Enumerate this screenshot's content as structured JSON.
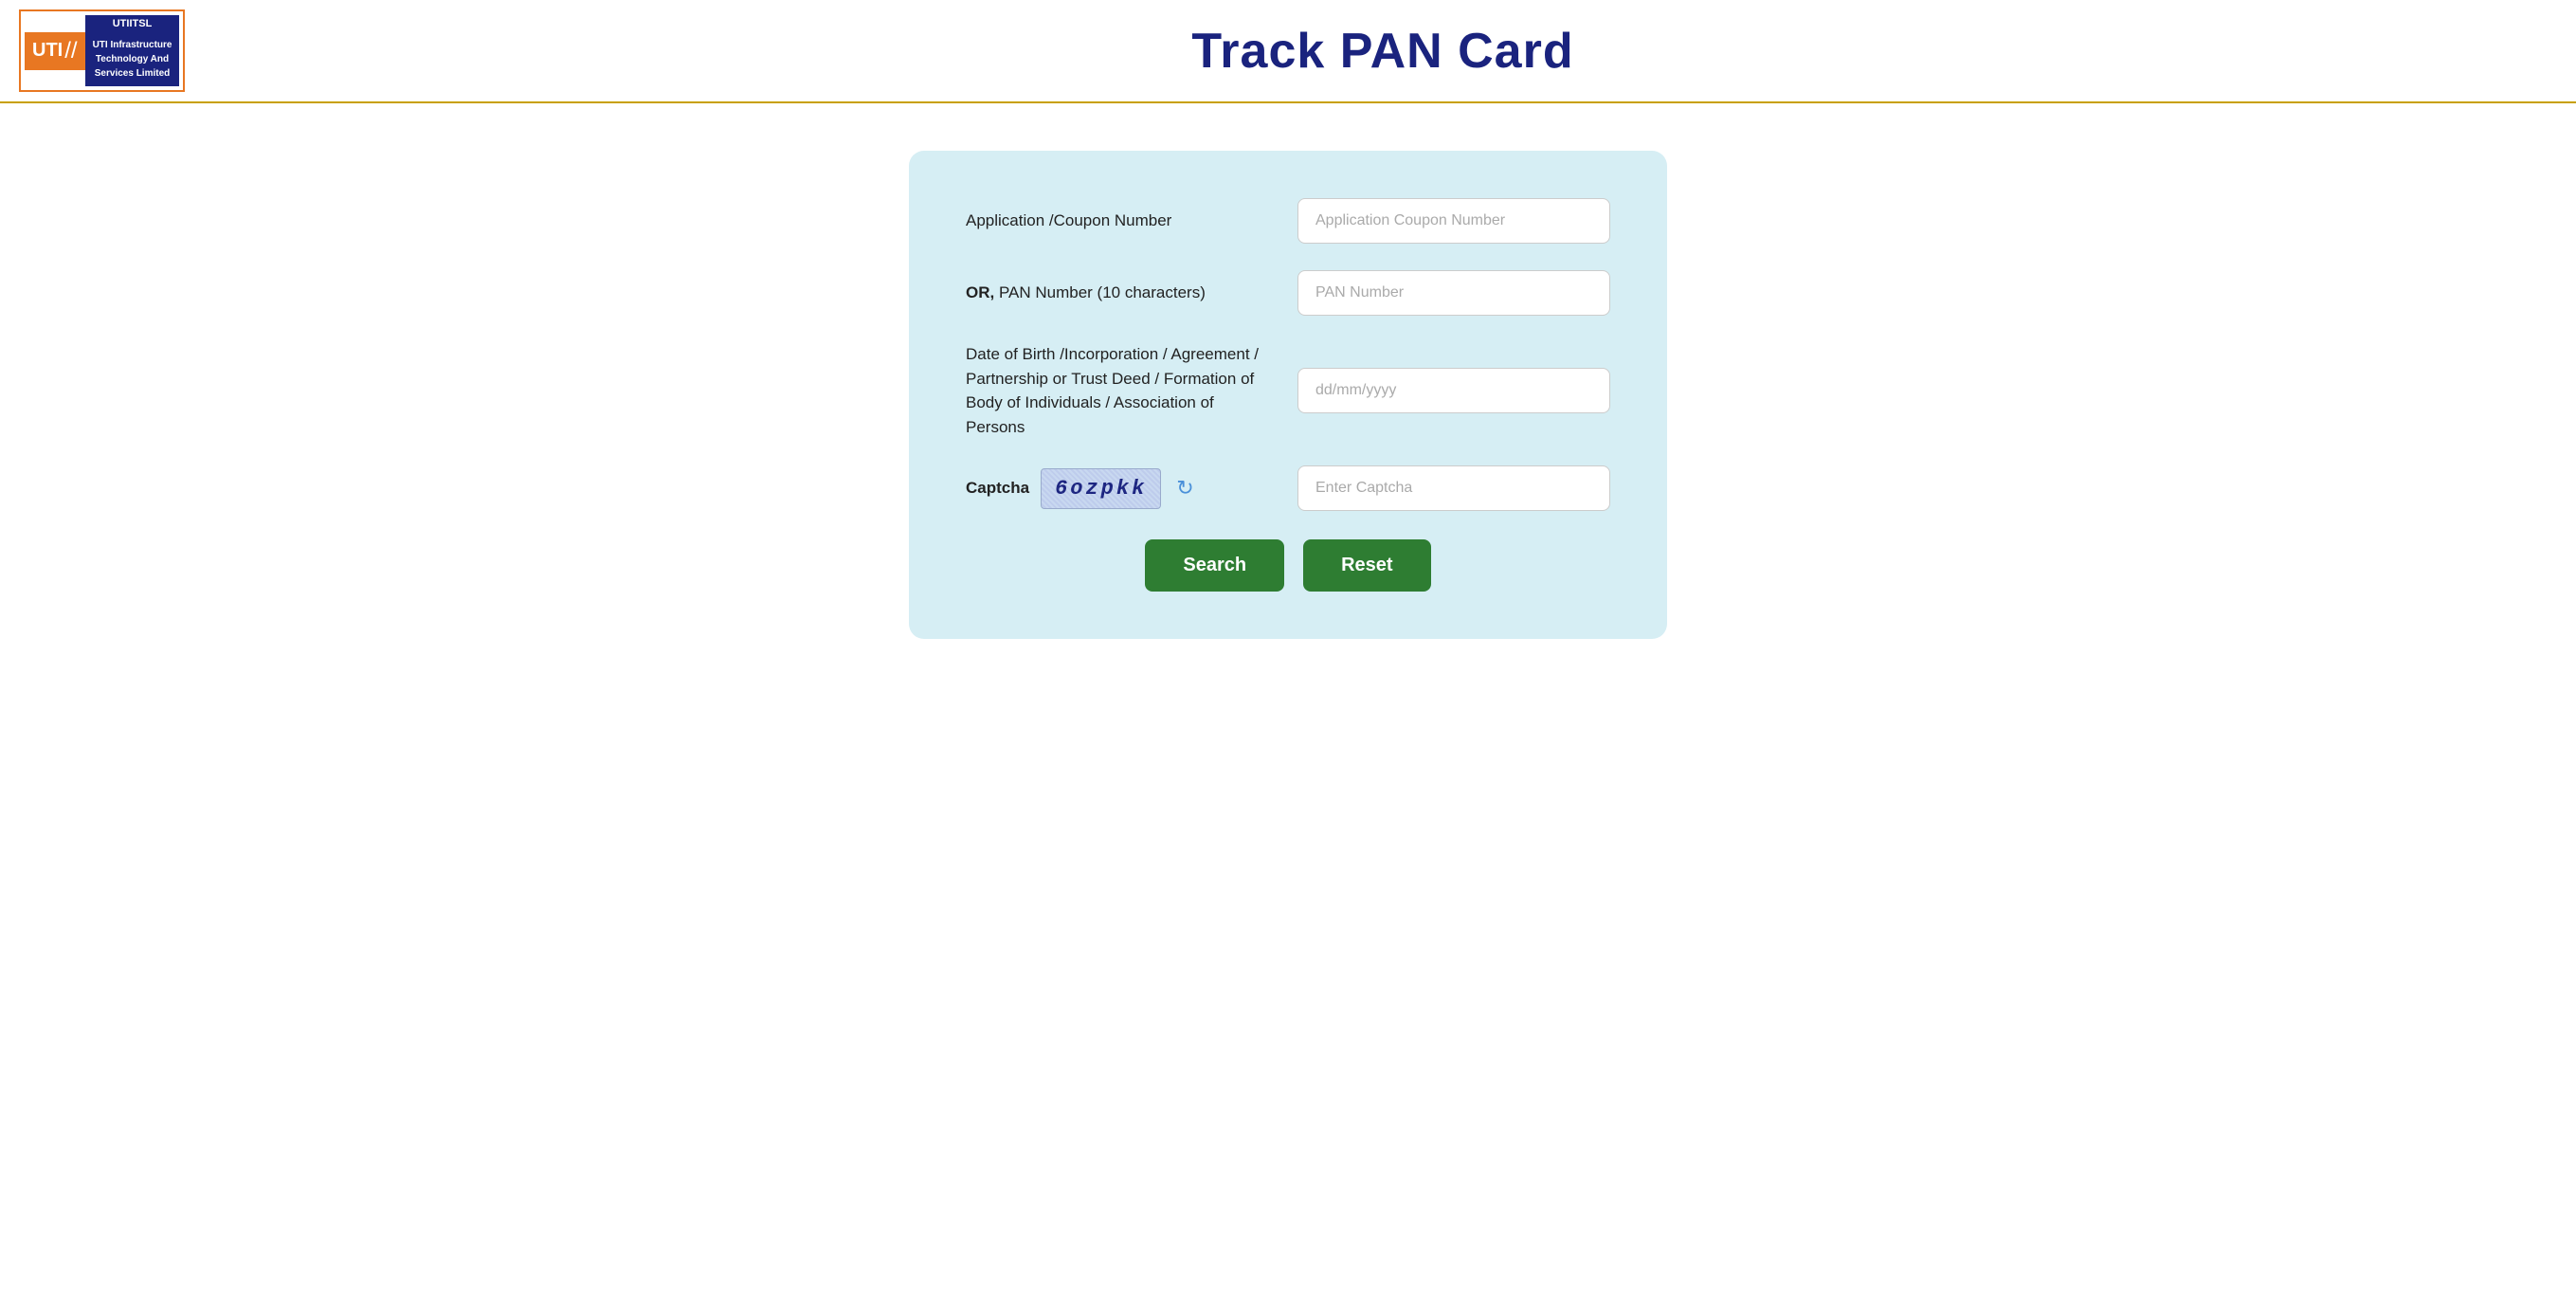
{
  "header": {
    "logo": {
      "uti_text": "uti",
      "slash": "//",
      "utiitsl_label": "UTIITSL",
      "company_name_line1": "UTI  Infrastructure",
      "company_name_line2": "Technology   And",
      "company_name_line3": "Services    Limited"
    },
    "title": "Track PAN Card"
  },
  "form": {
    "application_coupon_label": "Application /Coupon Number",
    "application_coupon_placeholder": "Application Coupon Number",
    "pan_number_label_prefix": "OR,",
    "pan_number_label_suffix": " PAN Number (10 characters)",
    "pan_number_placeholder": "PAN Number",
    "dob_label": "Date of Birth /Incorporation / Agreement / Partnership or Trust Deed / Formation of Body of Individuals / Association of Persons",
    "dob_placeholder": "dd/mm/yyyy",
    "captcha_label": "Captcha",
    "captcha_text": "6ozpkk",
    "captcha_placeholder": "Enter Captcha",
    "search_button": "Search",
    "reset_button": "Reset"
  }
}
